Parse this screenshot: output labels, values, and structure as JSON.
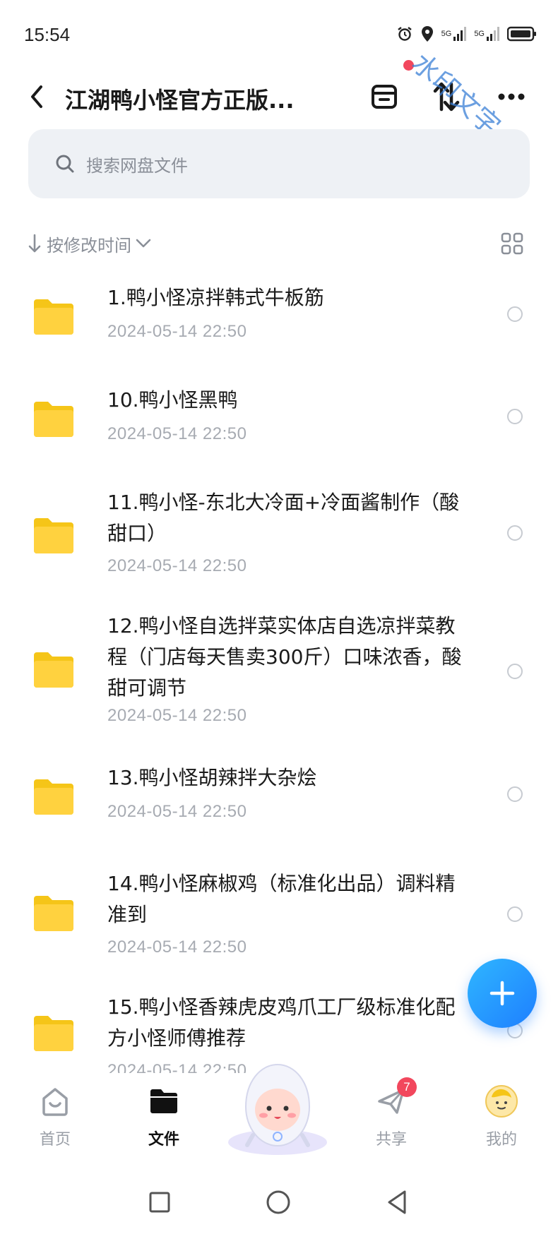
{
  "status_bar": {
    "time": "15:54",
    "icons": [
      "alarm-icon",
      "location-icon",
      "signal-5g-icon",
      "signal-5g-icon",
      "battery-icon"
    ],
    "network_label_1": "5G",
    "network_label_2": "5G"
  },
  "header": {
    "title": "江湖鸭小怪官方正版...",
    "back_icon": "chevron-left-icon",
    "actions": [
      "archive-icon",
      "sort-arrows-icon",
      "more-icon"
    ],
    "notification_dot_color": "#f2475d"
  },
  "watermark": "水印文字",
  "search": {
    "placeholder": "搜索网盘文件"
  },
  "sort": {
    "label": "按修改时间",
    "direction": "descending"
  },
  "files": [
    {
      "name": "1.鸭小怪凉拌韩式牛板筋",
      "date": "2024-05-14  22:50"
    },
    {
      "name": "10.鸭小怪黑鸭",
      "date": "2024-05-14  22:50"
    },
    {
      "name": "11.鸭小怪-东北大冷面+冷面酱制作（酸甜口）",
      "date": "2024-05-14  22:50"
    },
    {
      "name": "12.鸭小怪自选拌菜实体店自选凉拌菜教程（门店每天售卖300斤）口味浓香，酸甜可调节",
      "date": "2024-05-14  22:50"
    },
    {
      "name": "13.鸭小怪胡辣拌大杂烩",
      "date": "2024-05-14  22:50"
    },
    {
      "name": "14.鸭小怪麻椒鸡（标准化出品）调料精准到",
      "date": "2024-05-14  22:50"
    },
    {
      "name": "15.鸭小怪香辣虎皮鸡爪工厂级标准化配方小怪师傅推荐",
      "date": "2024-05-14  22:50"
    }
  ],
  "fab_icon": "plus-icon",
  "bottom_nav": [
    {
      "label": "首页",
      "icon": "home-icon",
      "active": false
    },
    {
      "label": "文件",
      "icon": "folder-icon",
      "active": true
    },
    {
      "label": "共享",
      "icon": "send-icon",
      "active": false,
      "badge": "7"
    },
    {
      "label": "我的",
      "icon": "avatar-icon",
      "active": false
    }
  ],
  "colors": {
    "folder": "#ffd23f",
    "accent": "#1e7fff",
    "badge": "#f2475d",
    "watermark": "#3a7fd6"
  }
}
